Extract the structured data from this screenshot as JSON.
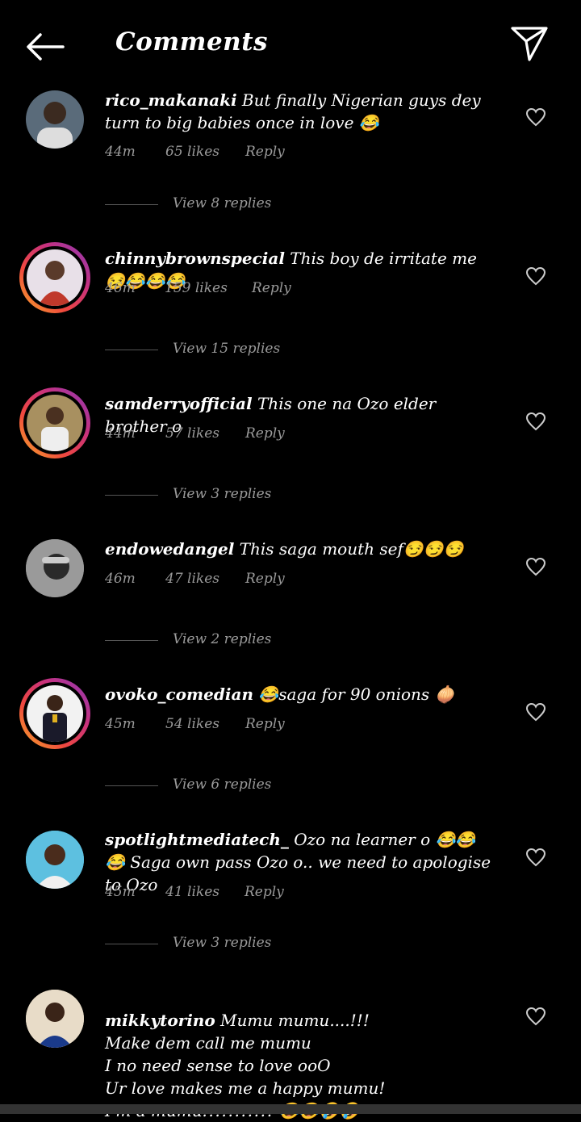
{
  "header": {
    "title": "Comments"
  },
  "comments": [
    {
      "username": "rico_makanaki",
      "text": " But finally Nigerian guys dey turn to big babies once in love 😂",
      "time": "44m",
      "likes": "65 likes",
      "reply": "Reply",
      "replies": "View 8 replies",
      "avatar_color": "#5a6b7a"
    },
    {
      "username": "chinnybrownspecial",
      "text": " This boy de irritate me😒😂😂😂",
      "time": "46m",
      "likes": "159 likes",
      "reply": "Reply",
      "replies": "View 15 replies",
      "avatar_color": "#c0392b"
    },
    {
      "username": "samderryofficial",
      "text": " This one na Ozo elder brother o",
      "time": "44m",
      "likes": "57 likes",
      "reply": "Reply",
      "replies": "View 3 replies",
      "avatar_color": "#8a7a4a"
    },
    {
      "username": "endowedangel",
      "text": " This saga mouth sef😏😏😏",
      "time": "46m",
      "likes": "47 likes",
      "reply": "Reply",
      "replies": "View 2 replies",
      "avatar_color": "#777777"
    },
    {
      "username": "ovoko_comedian",
      "text": " 😂saga for 90 onions 🧅",
      "time": "45m",
      "likes": "54 likes",
      "reply": "Reply",
      "replies": "View 6 replies",
      "avatar_color": "#2c3e50"
    },
    {
      "username": "spotlightmediatech_",
      "text": " Ozo na learner o 😂😂😂 Saga own pass Ozo o.. we need to apologise to Ozo",
      "time": "45m",
      "likes": "41 likes",
      "reply": "Reply",
      "replies": "View 3 replies",
      "avatar_color": "#3fa7c9"
    },
    {
      "username": "mikkytorino",
      "text": " Mumu mumu....!!!\nMake dem call me mumu\nI no need sense to love ooO\nUr love makes me a happy mumu!\nI'm a mumu!!!!!!!!!!! 😂😂🤣🤣",
      "avatar_color": "#d8c0a0"
    }
  ]
}
